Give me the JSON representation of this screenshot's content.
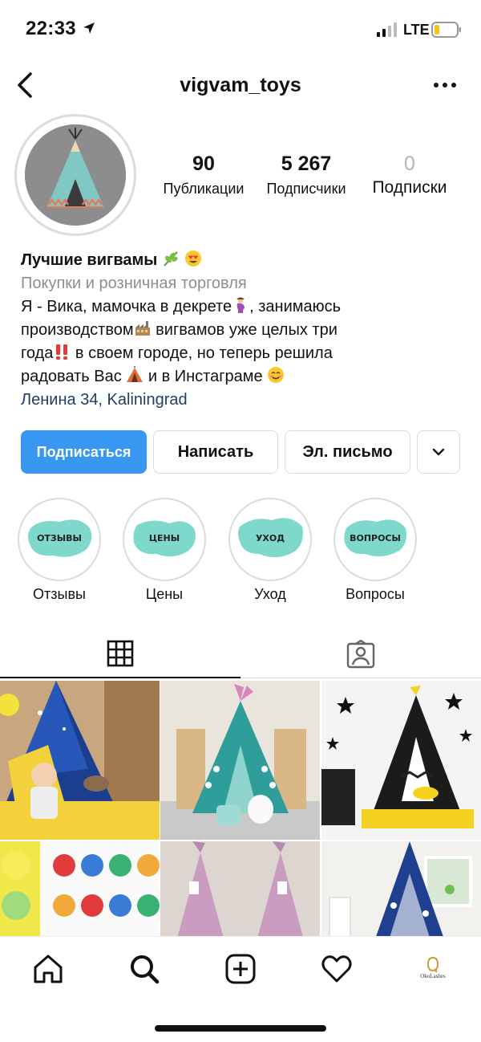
{
  "status_bar": {
    "time": "22:33",
    "network": "LTE"
  },
  "header": {
    "username": "vigvam_toys"
  },
  "stats": [
    {
      "value": "90",
      "label": "Публикации"
    },
    {
      "value": "5 267",
      "label": "Подписчики"
    },
    {
      "value": "0",
      "label": "Подписки"
    }
  ],
  "bio": {
    "name": "Лучшие вигвамы",
    "category": "Покупки и розничная торговля",
    "line1a": "Я - Вика, мамочка в декрете",
    "line1b": ", занимаюсь",
    "line2a": "производством",
    "line2b": " вигвамов уже целых три",
    "line3a": "года",
    "line3b": " в своем городе, но теперь решила",
    "line4a": "радовать Вас",
    "line4b": " и в Инстаграме",
    "address": "Ленина 34, Kaliningrad"
  },
  "buttons": {
    "follow": "Подписаться",
    "message": "Написать",
    "email": "Эл. письмо"
  },
  "highlights": [
    {
      "tag": "ОТЗЫВЫ",
      "label": "Отзывы"
    },
    {
      "tag": "ЦЕНЫ",
      "label": "Цены"
    },
    {
      "tag": "УХОД",
      "label": "Уход"
    },
    {
      "tag": "ВОПРОСЫ",
      "label": "Вопросы"
    }
  ],
  "bottom_nav": {
    "profile_brand": "OkoLashes"
  },
  "colors": {
    "accent": "#3897f0",
    "link": "#1f3e64",
    "mint": "#7fd8cc"
  }
}
